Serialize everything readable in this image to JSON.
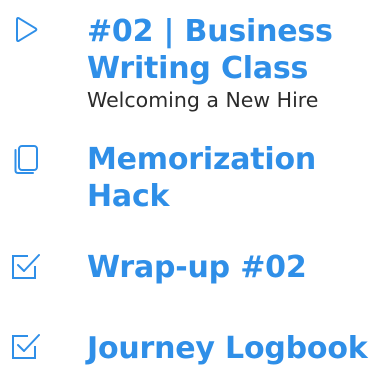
{
  "colors": {
    "accent": "#2f8fe8",
    "text": "#2b2b2b",
    "background": "#ffffff"
  },
  "lessons": [
    {
      "icon": "play-icon",
      "title_lines": [
        "#02 | Business",
        "Writing Class"
      ],
      "subtitle": "Welcoming a New Hire"
    },
    {
      "icon": "flashcards-icon",
      "title_lines": [
        "Memorization",
        "Hack"
      ]
    },
    {
      "icon": "checkbox-icon",
      "title_lines": [
        "Wrap-up #02"
      ]
    },
    {
      "icon": "checkbox-icon",
      "title_lines": [
        "Journey Logbook"
      ]
    }
  ]
}
